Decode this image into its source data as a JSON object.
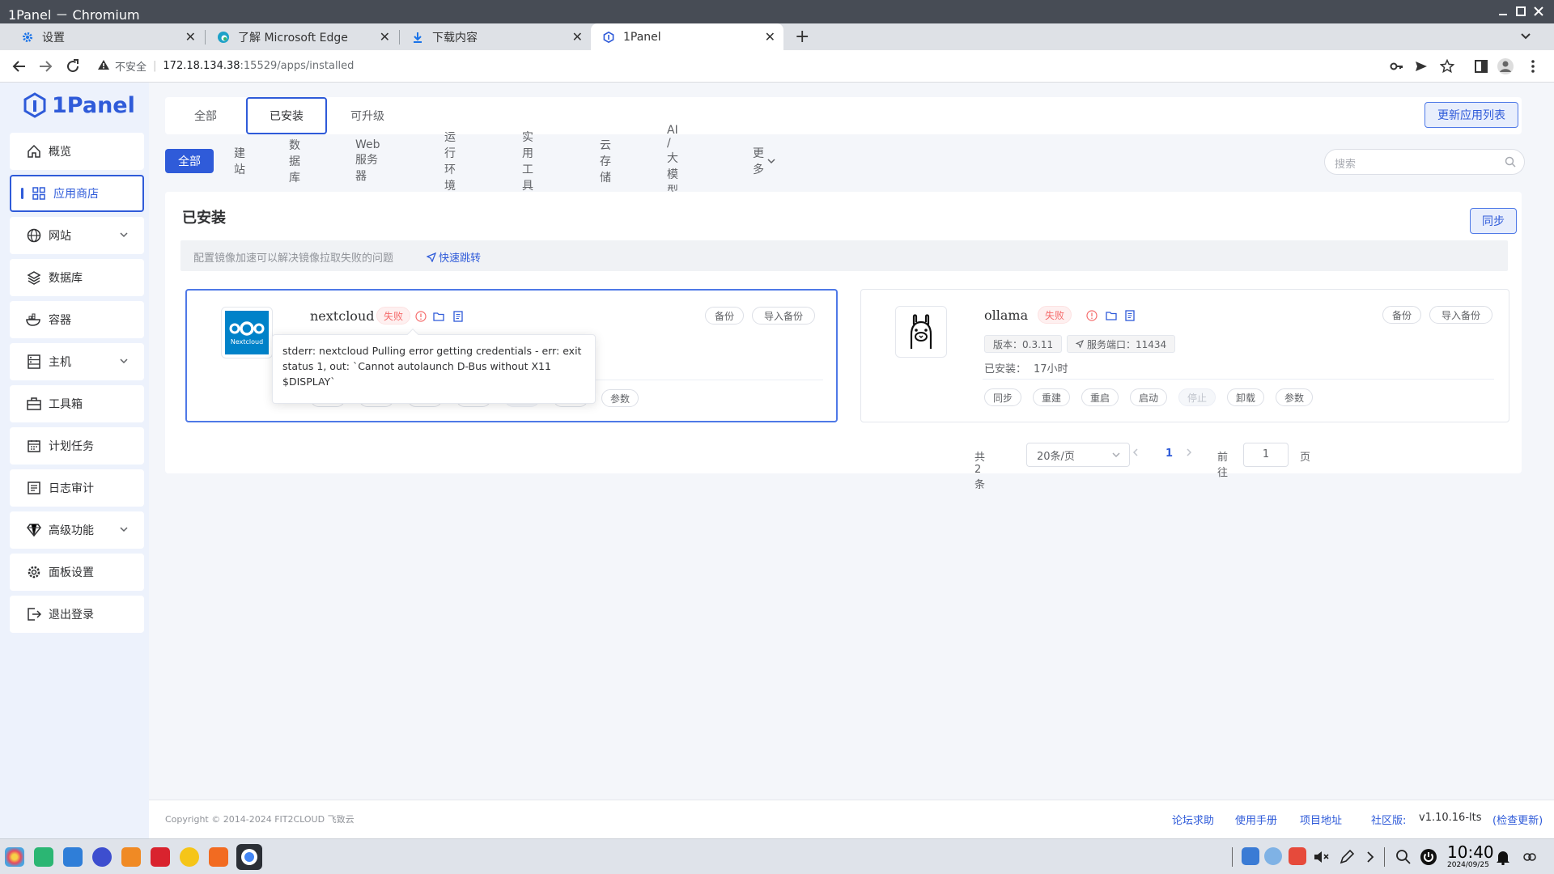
{
  "window": {
    "title": "1Panel － Chromium"
  },
  "tabs": [
    {
      "label": "设置",
      "icon": "gear-icon"
    },
    {
      "label": "了解 Microsoft Edge",
      "icon": "edge-icon"
    },
    {
      "label": "下载内容",
      "icon": "download-icon"
    },
    {
      "label": "1Panel",
      "icon": "1panel-icon"
    }
  ],
  "address": {
    "insecure_label": "不安全",
    "host": "172.18.134.38",
    "path": ":15529/apps/installed"
  },
  "sidebar": {
    "logo": "1Panel",
    "items": [
      {
        "label": "概览",
        "icon": "home-icon"
      },
      {
        "label": "应用商店",
        "icon": "grid-icon"
      },
      {
        "label": "网站",
        "icon": "globe-icon"
      },
      {
        "label": "数据库",
        "icon": "layers-icon"
      },
      {
        "label": "容器",
        "icon": "docker-icon"
      },
      {
        "label": "主机",
        "icon": "server-icon"
      },
      {
        "label": "工具箱",
        "icon": "toolbox-icon"
      },
      {
        "label": "计划任务",
        "icon": "calendar-icon"
      },
      {
        "label": "日志审计",
        "icon": "log-icon"
      },
      {
        "label": "高级功能",
        "icon": "diamond-icon"
      },
      {
        "label": "面板设置",
        "icon": "settings-icon"
      },
      {
        "label": "退出登录",
        "icon": "logout-icon"
      }
    ]
  },
  "segments": {
    "all": "全部",
    "installed": "已安装",
    "upgradable": "可升级",
    "refresh": "更新应用列表"
  },
  "categories": [
    "全部",
    "建站",
    "数据库",
    "Web 服务器",
    "运行环境",
    "实用工具",
    "云存储",
    "AI / 大模型",
    "更多"
  ],
  "search": {
    "placeholder": "搜索"
  },
  "installed": {
    "title": "已安装",
    "sync": "同步",
    "notice": "配置镜像加速可以解决镜像拉取失败的问题",
    "notice_link": "快速跳转"
  },
  "apps": [
    {
      "name": "nextcloud",
      "status": "失败",
      "logo_text": "Nextcloud",
      "backup": "备份",
      "import_backup": "导入备份",
      "params": "参数",
      "tooltip": "stderr: nextcloud Pulling error getting credentials - err: exit status 1, out: `Cannot autolaunch D-Bus without X11 $DISPLAY`"
    },
    {
      "name": "ollama",
      "status": "失败",
      "backup": "备份",
      "import_backup": "导入备份",
      "version": "版本：0.3.11",
      "port": "服务端口：11434",
      "installed_label": "已安装：",
      "installed_time": "17小时",
      "actions": [
        "同步",
        "重建",
        "重启",
        "启动",
        "停止",
        "卸载",
        "参数"
      ]
    }
  ],
  "pagination": {
    "total": "共 2 条",
    "page_size": "20条/页",
    "current": "1",
    "goto": "前往",
    "goto_value": "1",
    "page_unit": "页"
  },
  "footer": {
    "copyright": "Copyright © 2014-2024 FIT2CLOUD 飞致云",
    "forum": "论坛求助",
    "manual": "使用手册",
    "project": "项目地址",
    "edition": "社区版:",
    "version": "v1.10.16-lts",
    "check_update": "(检查更新)"
  },
  "clock": {
    "time": "10:40",
    "date": "2024/09/25"
  },
  "colors": {
    "primary": "#2f5bd9",
    "danger": "#f56c6c",
    "nextcloud": "#0082c9"
  }
}
